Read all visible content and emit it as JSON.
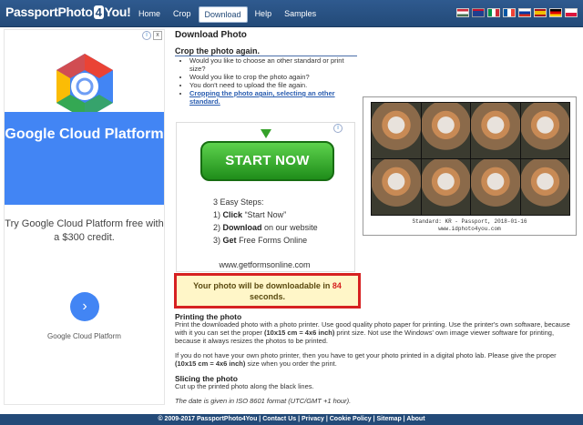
{
  "header": {
    "logo_left": "PassportPhoto",
    "logo_four": "4",
    "logo_right": "You!",
    "nav": [
      {
        "label": "Home"
      },
      {
        "label": "Crop"
      },
      {
        "label": "Download",
        "active": true
      },
      {
        "label": "Help"
      },
      {
        "label": "Samples"
      }
    ],
    "flags": [
      "hu",
      "uk",
      "it",
      "fr",
      "ru",
      "es",
      "de",
      "pl"
    ]
  },
  "left_ad": {
    "close": "x",
    "info": "i",
    "headline": "Google Cloud Platform",
    "body": "Try Google Cloud Platform free with a $300 credit.",
    "button_arrow": "›",
    "footer": "Google Cloud Platform"
  },
  "main": {
    "title": "Download Photo",
    "crop_section_title": "Crop the photo again.",
    "crop_items": [
      "Would you like to choose an other standard or print size?",
      "Would you like to crop the photo again?",
      "You don't need to upload the file again."
    ],
    "crop_link": "Cropping the photo again, selecting an other standard."
  },
  "mid_ad": {
    "info": "i",
    "button": "START NOW",
    "steps_title": "3 Easy Steps:",
    "step1_num": "1)",
    "step1_bold": "Click",
    "step1_rest": "“Start Now”",
    "step2_num": "2)",
    "step2_bold": "Download",
    "step2_rest": "on our website",
    "step3_num": "3)",
    "step3_bold": "Get",
    "step3_rest": "Free Forms Online",
    "url": "www.getformsonline.com"
  },
  "countdown": {
    "text_before": "Your photo will be downloadable in",
    "seconds": "84",
    "text_after": "seconds."
  },
  "sheet": {
    "caption_line1": "Standard: KR - Passport, 2018-01-16",
    "caption_line2": "www.idphoto4you.com"
  },
  "printing": {
    "title": "Printing the photo",
    "para1_part1": "Print the downloaded photo with a photo printer. Use good quality photo paper for printing. Use the printer's own software, because with it you can set the proper",
    "para1_bold": "(10x15 cm = 4x6 inch)",
    "para1_part2": "print size. Not use the Windows' own image viewer software for printing, because it always resizes the photos to be printed.",
    "para2_part1": "If you do not have your own photo printer, then you have to get your photo printed in a digital photo lab. Please give the proper",
    "para2_bold": "(10x15 cm = 4x6 inch)",
    "para2_part2": "size when you order the print."
  },
  "slicing": {
    "title": "Slicing the photo",
    "text": "Cut up the printed photo along the black lines.",
    "date_note": "The date is given in ISO 8601 format (UTC/GMT +1 hour)."
  },
  "footer": {
    "text": "© 2009-2017 PassportPhoto4You | Contact Us | Privacy | Cookie Policy | Sitemap | About"
  },
  "colors": {
    "header": "#234a78",
    "google_blue": "#4285f4",
    "start_green": "#35a12a",
    "countdown_border": "#d62121",
    "countdown_bg": "#fff6c8"
  }
}
